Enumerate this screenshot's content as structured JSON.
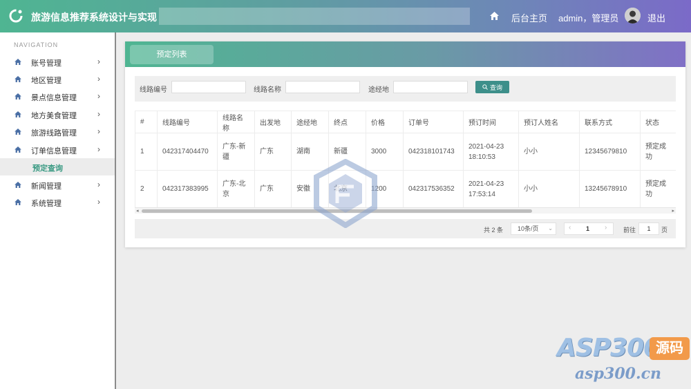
{
  "header": {
    "app_title": "旅游信息推荐系统设计与实现",
    "home_label": "后台主页",
    "user_label": "admin，管理员",
    "logout_label": "退出"
  },
  "sidebar": {
    "heading": "NAVIGATION",
    "items": [
      {
        "label": "账号管理"
      },
      {
        "label": "地区管理"
      },
      {
        "label": "景点信息管理"
      },
      {
        "label": "地方美食管理"
      },
      {
        "label": "旅游线路管理"
      },
      {
        "label": "订单信息管理"
      },
      {
        "label": "预定查询"
      },
      {
        "label": "新闻管理"
      },
      {
        "label": "系统管理"
      }
    ]
  },
  "card": {
    "tab_label": "预定列表"
  },
  "search": {
    "route_no_label": "线路编号",
    "route_name_label": "线路名称",
    "via_label": "途经地",
    "button_label": "查询"
  },
  "table": {
    "headers": [
      "#",
      "线路编号",
      "线路名称",
      "出发地",
      "途经地",
      "终点",
      "价格",
      "订单号",
      "预订时间",
      "预订人姓名",
      "联系方式",
      "状态"
    ],
    "rows": [
      [
        "1",
        "042317404470",
        "广东-新疆",
        "广东",
        "湖南",
        "新疆",
        "3000",
        "042318101743",
        "2021-04-23 18:10:53",
        "小小",
        "12345679810",
        "预定成功"
      ],
      [
        "2",
        "042317383995",
        "广东-北京",
        "广东",
        "安徽",
        "北京",
        "1200",
        "042317536352",
        "2021-04-23 17:53:14",
        "小小",
        "13245678910",
        "预定成功"
      ]
    ]
  },
  "pager": {
    "total_label": "共 2 条",
    "page_size": "10条/页",
    "current_page": "1",
    "goto_label": "前往",
    "goto_value": "1",
    "page_suffix": "页"
  },
  "watermark": {
    "brand": "ASP300",
    "tag": "源码",
    "url": "asp300.cn"
  },
  "colors": {
    "accent": "#3d8f8a",
    "header_start": "#4fb592",
    "header_end": "#7b6ac8"
  }
}
